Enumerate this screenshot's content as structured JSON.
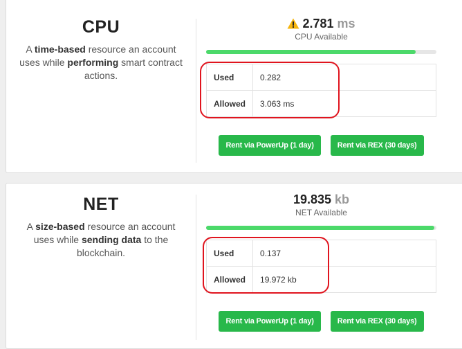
{
  "cpu": {
    "title": "CPU",
    "desc_parts": [
      "A ",
      "time-based",
      " resource an account uses while ",
      "performing",
      " smart contract actions."
    ],
    "available_value": "2.781",
    "available_unit": "ms",
    "available_label": "CPU Available",
    "warning_icon": "warning-triangle-icon",
    "usage_fraction": 0.91,
    "stats": [
      {
        "label": "Used",
        "value": "0.282"
      },
      {
        "label": "Allowed",
        "value": "3.063 ms"
      }
    ],
    "buttons": [
      "Rent via PowerUp (1 day)",
      "Rent via REX (30 days)"
    ]
  },
  "net": {
    "title": "NET",
    "desc_parts": [
      "A ",
      "size-based",
      " resource an account uses while ",
      "sending data",
      " to the blockchain."
    ],
    "available_value": "19.835",
    "available_unit": "kb",
    "available_label": "NET Available",
    "usage_fraction": 0.99,
    "stats": [
      {
        "label": "Used",
        "value": "0.137"
      },
      {
        "label": "Allowed",
        "value": "19.972 kb"
      }
    ],
    "buttons": [
      "Rent via PowerUp (1 day)",
      "Rent via REX (30 days)"
    ]
  },
  "colors": {
    "accent_green": "#28b84a",
    "bar_green": "#4cd96a",
    "highlight_red": "#e0141e",
    "warning_yellow": "#f6b50e"
  }
}
